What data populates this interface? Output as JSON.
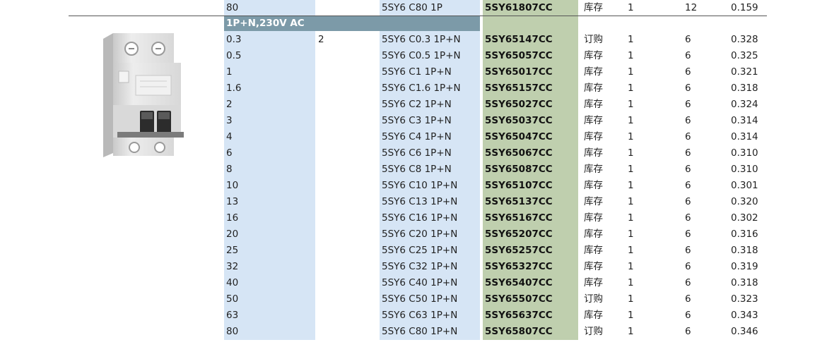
{
  "top_row": {
    "value": "80",
    "model": "5SY6 C80 1P",
    "code": "5SY61807CC",
    "stock": "库存",
    "qty1": "1",
    "qty2": "12",
    "weight": "0.159"
  },
  "section": {
    "title": "1P+N,230V AC"
  },
  "rows": [
    {
      "value": "0.3",
      "poles": "2",
      "model": "5SY6 C0.3 1P+N",
      "code": "5SY65147CC",
      "stock": "订购",
      "qty1": "1",
      "qty2": "6",
      "weight": "0.328"
    },
    {
      "value": "0.5",
      "poles": "",
      "model": "5SY6 C0.5 1P+N",
      "code": "5SY65057CC",
      "stock": "库存",
      "qty1": "1",
      "qty2": "6",
      "weight": "0.325"
    },
    {
      "value": "1",
      "poles": "",
      "model": "5SY6 C1 1P+N",
      "code": "5SY65017CC",
      "stock": "库存",
      "qty1": "1",
      "qty2": "6",
      "weight": "0.321"
    },
    {
      "value": "1.6",
      "poles": "",
      "model": "5SY6 C1.6 1P+N",
      "code": "5SY65157CC",
      "stock": "库存",
      "qty1": "1",
      "qty2": "6",
      "weight": "0.318"
    },
    {
      "value": "2",
      "poles": "",
      "model": "5SY6 C2 1P+N",
      "code": "5SY65027CC",
      "stock": "库存",
      "qty1": "1",
      "qty2": "6",
      "weight": "0.324"
    },
    {
      "value": "3",
      "poles": "",
      "model": "5SY6 C3 1P+N",
      "code": "5SY65037CC",
      "stock": "库存",
      "qty1": "1",
      "qty2": "6",
      "weight": "0.314"
    },
    {
      "value": "4",
      "poles": "",
      "model": "5SY6 C4 1P+N",
      "code": "5SY65047CC",
      "stock": "库存",
      "qty1": "1",
      "qty2": "6",
      "weight": "0.314"
    },
    {
      "value": "6",
      "poles": "",
      "model": "5SY6 C6 1P+N",
      "code": "5SY65067CC",
      "stock": "库存",
      "qty1": "1",
      "qty2": "6",
      "weight": "0.310"
    },
    {
      "value": "8",
      "poles": "",
      "model": "5SY6 C8 1P+N",
      "code": "5SY65087CC",
      "stock": "库存",
      "qty1": "1",
      "qty2": "6",
      "weight": "0.310"
    },
    {
      "value": "10",
      "poles": "",
      "model": "5SY6 C10 1P+N",
      "code": "5SY65107CC",
      "stock": "库存",
      "qty1": "1",
      "qty2": "6",
      "weight": "0.301"
    },
    {
      "value": "13",
      "poles": "",
      "model": "5SY6 C13 1P+N",
      "code": "5SY65137CC",
      "stock": "库存",
      "qty1": "1",
      "qty2": "6",
      "weight": "0.320"
    },
    {
      "value": "16",
      "poles": "",
      "model": "5SY6 C16 1P+N",
      "code": "5SY65167CC",
      "stock": "库存",
      "qty1": "1",
      "qty2": "6",
      "weight": "0.302"
    },
    {
      "value": "20",
      "poles": "",
      "model": "5SY6 C20 1P+N",
      "code": "5SY65207CC",
      "stock": "库存",
      "qty1": "1",
      "qty2": "6",
      "weight": "0.316"
    },
    {
      "value": "25",
      "poles": "",
      "model": "5SY6 C25 1P+N",
      "code": "5SY65257CC",
      "stock": "库存",
      "qty1": "1",
      "qty2": "6",
      "weight": "0.318"
    },
    {
      "value": "32",
      "poles": "",
      "model": "5SY6 C32 1P+N",
      "code": "5SY65327CC",
      "stock": "库存",
      "qty1": "1",
      "qty2": "6",
      "weight": "0.319"
    },
    {
      "value": "40",
      "poles": "",
      "model": "5SY6 C40 1P+N",
      "code": "5SY65407CC",
      "stock": "库存",
      "qty1": "1",
      "qty2": "6",
      "weight": "0.318"
    },
    {
      "value": "50",
      "poles": "",
      "model": "5SY6 C50 1P+N",
      "code": "5SY65507CC",
      "stock": "订购",
      "qty1": "1",
      "qty2": "6",
      "weight": "0.323"
    },
    {
      "value": "63",
      "poles": "",
      "model": "5SY6 C63 1P+N",
      "code": "5SY65637CC",
      "stock": "库存",
      "qty1": "1",
      "qty2": "6",
      "weight": "0.343"
    },
    {
      "value": "80",
      "poles": "",
      "model": "5SY6 C80 1P+N",
      "code": "5SY65807CC",
      "stock": "订购",
      "qty1": "1",
      "qty2": "6",
      "weight": "0.346"
    }
  ],
  "colors": {
    "value_column": "#d6e5f5",
    "code_column": "#bfcfae",
    "section_bar": "#7c9aa8"
  },
  "image": {
    "icon": "circuit-breaker-product-photo"
  }
}
